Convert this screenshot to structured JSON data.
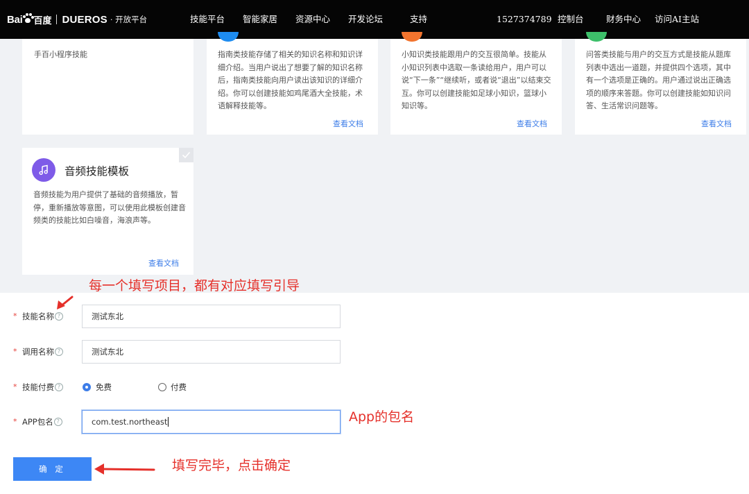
{
  "header": {
    "logo_bai": "Bai",
    "logo_baidu": "百度",
    "logo_dueros": "DUEROS",
    "logo_open": "· 开放平台",
    "nav_left": [
      "技能平台",
      "智能家居",
      "资源中心",
      "开发论坛",
      "支持"
    ],
    "user_id": "1527374789",
    "nav_right": [
      "控制台",
      "财务中心",
      "访问AI主站"
    ]
  },
  "cards": [
    {
      "desc": "手百小程序技能"
    },
    {
      "desc": "指南类技能存储了相关的知识名称和知识详细介绍。当用户说出了想要了解的知识名称后，指南类技能向用户读出该知识的详细介绍。你可以创建技能如鸡尾酒大全技能，术语解释技能等。",
      "doc_link": "查看文档",
      "badge_color": "#1e8cf0"
    },
    {
      "desc": "小知识类技能跟用户的交互很简单。技能从小知识列表中选取一条读给用户，用户可以说“下一条”“继续听，或者说“退出”以结束交互。你可以创建技能如足球小知识，篮球小知识等。",
      "doc_link": "查看文档",
      "badge_color": "#f2742e"
    },
    {
      "desc": "问答类技能与用户的交互方式是技能从题库列表中选出一道题，并提供四个选项，其中有一个选项是正确的。用户通过说出正确选项的顺序来答题。你可以创建技能如知识问答、生活常识问题等。",
      "doc_link": "查看文档",
      "badge_color": "#3dbf6a"
    },
    {
      "title": "音频技能模板",
      "desc": "音频技能为用户提供了基础的音频播放，暂停，重新播放等意图，可以使用此模板创建音频类的技能比如白噪音，海浪声等。",
      "doc_link": "查看文档",
      "icon_color": "#7e5be8"
    }
  ],
  "form": {
    "required_mark": "*",
    "skill_name": {
      "label": "技能名称",
      "value": "测试东北"
    },
    "invoke_name": {
      "label": "调用名称",
      "value": "测试东北"
    },
    "payment": {
      "label": "技能付费",
      "options": [
        "免费",
        "付费"
      ],
      "selected": "免费"
    },
    "app_package": {
      "label": "APP包名",
      "value": "com.test.northeast"
    },
    "help_glyph": "?",
    "confirm_label": "确 定"
  },
  "annotations": {
    "guide_note": "每一个填写项目，都有对应填写引导",
    "app_note": "App的包名",
    "confirm_note": "填写完毕，点击确定"
  },
  "colors": {
    "accent": "#3d87f5",
    "link": "#3d7de8",
    "annotation_red": "#e5302a",
    "topbar": "#050505"
  }
}
